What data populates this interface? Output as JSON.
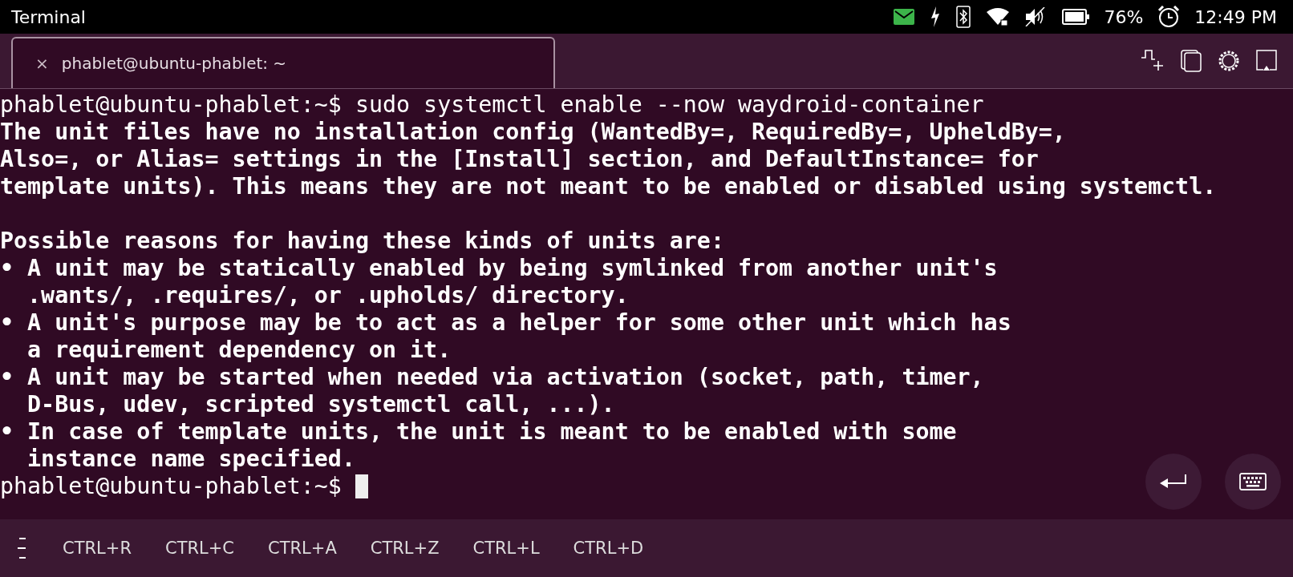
{
  "status_bar": {
    "app_title": "Terminal",
    "battery": "76%",
    "time": "12:49 PM"
  },
  "tabs": [
    {
      "label": "phablet@ubuntu-phablet: ~",
      "selected": true,
      "close": "×"
    }
  ],
  "terminal": {
    "lines": [
      {
        "kind": "prompt",
        "text": "phablet@ubuntu-phablet:~$ sudo systemctl enable --now waydroid-container"
      },
      {
        "kind": "output",
        "text": "The unit files have no installation config (WantedBy=, RequiredBy=, UpheldBy=,"
      },
      {
        "kind": "output",
        "text": "Also=, or Alias= settings in the [Install] section, and DefaultInstance= for"
      },
      {
        "kind": "output",
        "text": "template units). This means they are not meant to be enabled or disabled using systemctl."
      },
      {
        "kind": "blank"
      },
      {
        "kind": "output",
        "text": "Possible reasons for having these kinds of units are:"
      },
      {
        "kind": "output",
        "text": "• A unit may be statically enabled by being symlinked from another unit's"
      },
      {
        "kind": "output",
        "text": "  .wants/, .requires/, or .upholds/ directory."
      },
      {
        "kind": "output",
        "text": "• A unit's purpose may be to act as a helper for some other unit which has"
      },
      {
        "kind": "output",
        "text": "  a requirement dependency on it."
      },
      {
        "kind": "output",
        "text": "• A unit may be started when needed via activation (socket, path, timer,"
      },
      {
        "kind": "output",
        "text": "  D-Bus, udev, scripted systemctl call, ...)."
      },
      {
        "kind": "output",
        "text": "• In case of template units, the unit is meant to be enabled with some"
      },
      {
        "kind": "output",
        "text": "  instance name specified."
      },
      {
        "kind": "prompt",
        "text": "phablet@ubuntu-phablet:~$ ",
        "cursor": true
      }
    ]
  },
  "shortcuts": [
    "CTRL+R",
    "CTRL+C",
    "CTRL+A",
    "CTRL+Z",
    "CTRL+L",
    "CTRL+D"
  ]
}
